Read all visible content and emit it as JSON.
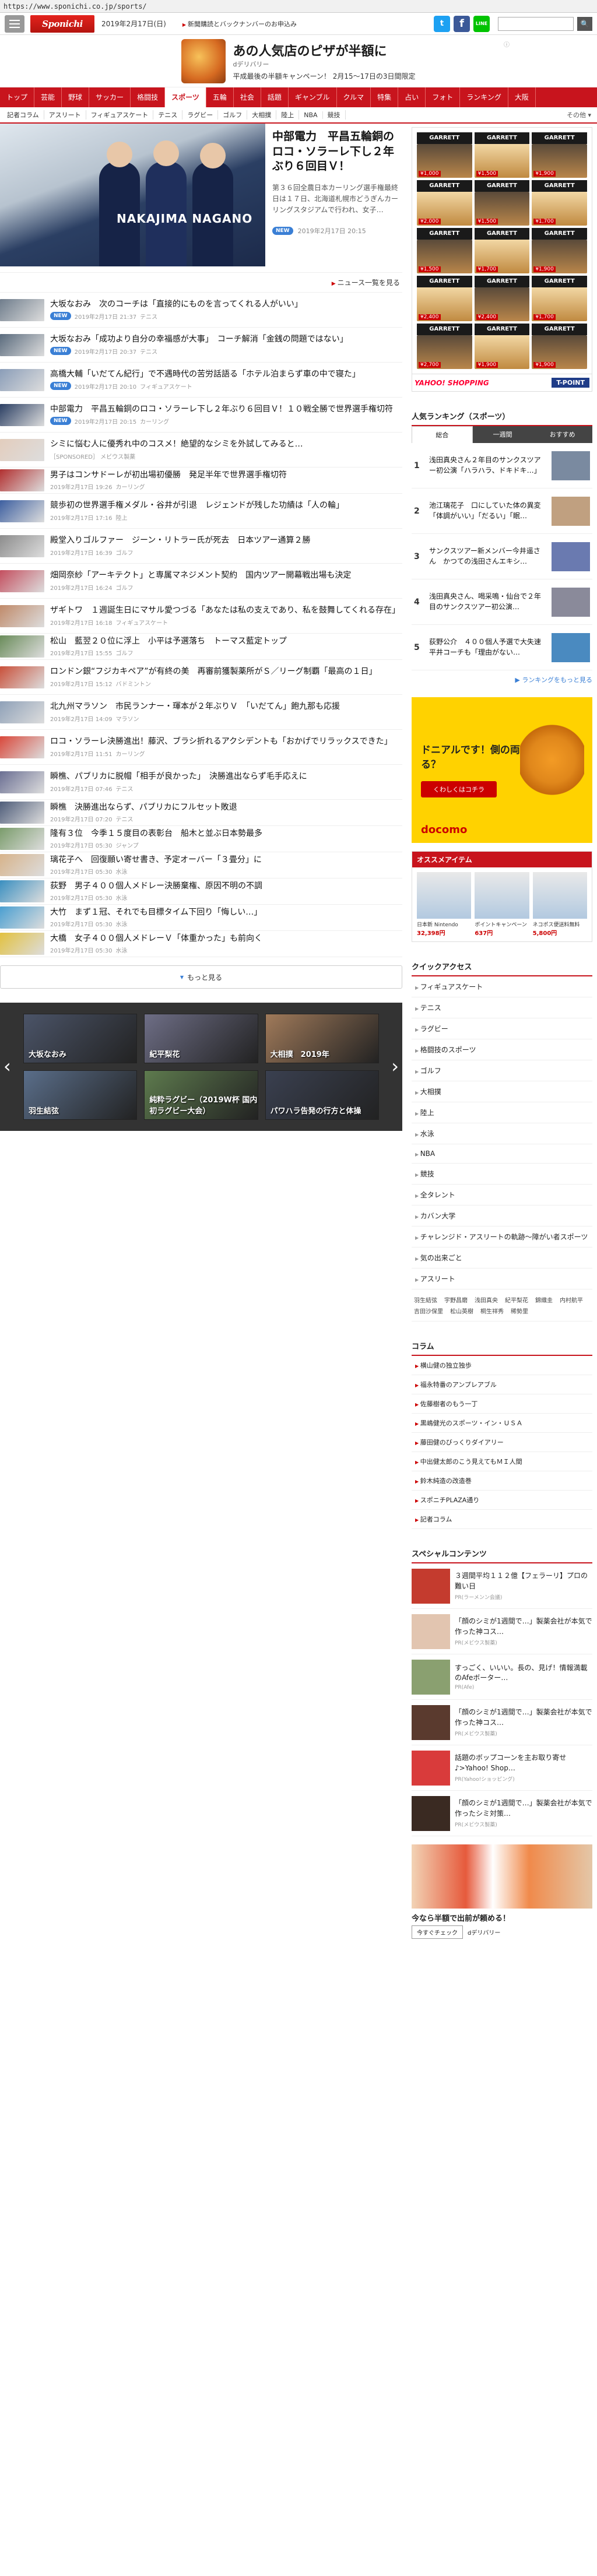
{
  "browser": {
    "url": "https://www.sponichi.co.jp/sports/"
  },
  "header": {
    "logo_text": "Sponichi Annex",
    "date": "2019年2月17日(日)",
    "subscribe": "新聞購読とバックナンバーのお申込み",
    "search_placeholder": "",
    "search_button": "🔍"
  },
  "ad_banner": {
    "title": "あの人気店のピザが半額に",
    "sub": "dデリバリー",
    "campaign": "平成最後の半額キャンペーン！ 2月15～17日の3日間限定",
    "info": "ⓘ"
  },
  "nav": {
    "categories": [
      "トップ",
      "芸能",
      "野球",
      "サッカー",
      "格闘技",
      "スポーツ",
      "五輪",
      "社会",
      "話題",
      "ギャンブル",
      "クルマ",
      "特集",
      "占い",
      "フォト",
      "ランキング",
      "大阪"
    ],
    "active": "スポーツ",
    "sub": [
      "記者コラム",
      "アスリート",
      "フィギュアスケート",
      "テニス",
      "ラグビー",
      "ゴルフ",
      "大相撲",
      "陸上",
      "NBA",
      "競技"
    ],
    "sub_more": "その他 ▾"
  },
  "hero": {
    "title": "中部電力　平昌五輪銅のロコ・ソラーレ下し２年ぶり６回目Ｖ！",
    "desc": "第３６回全農日本カーリング選手権最終日は１７日、北海道札幌市どうぎんカーリングスタジアムで行われ、女子…",
    "badge": "NEW",
    "time": "2019年2月17日 20:15",
    "banner_text": "NAKAJIMA  NAGANO"
  },
  "news_list_link": "ニュース一覧を見る",
  "articles": [
    {
      "title": "大坂なおみ　次のコーチは「直接的にものを言ってくれる人がいい」",
      "meta": "2019年2月17日 21:37",
      "cat": "テニス",
      "new": true,
      "color": "#6f7d8c"
    },
    {
      "title": "大坂なおみ「成功より自分の幸福感が大事」　コーチ解消「金銭の問題ではない」",
      "meta": "2019年2月17日 20:37",
      "cat": "テニス",
      "new": true,
      "color": "#5a6b7d"
    },
    {
      "title": "高橋大輔「いだてん紀行」で不遇時代の苦労話語る「ホテル泊まらず車の中で寝た」",
      "meta": "2019年2月17日 20:10",
      "cat": "フィギュアスケート",
      "new": true,
      "color": "#8a9db8"
    },
    {
      "title": "中部電力　平昌五輪銅のロコ・ソラーレ下し２年ぶり６回目Ｖ！１０戦全勝で世界選手権切符",
      "meta": "2019年2月17日 20:15",
      "cat": "カーリング",
      "new": true,
      "color": "#2b3f63"
    },
    {
      "title": "シミに悩む人に優秀れ中のコスメ！絶望的なシミを外試してみると…",
      "meta": "［SPONSORED］ メビウス製薬",
      "cat": "",
      "new": false,
      "color": "#e3cdbd"
    },
    {
      "title": "男子はコンサドーレが初出場初優勝　発足半年で世界選手権切符",
      "meta": "2019年2月17日 19:26",
      "cat": "カーリング",
      "new": false,
      "color": "#b23030"
    },
    {
      "title": "競歩初の世界選手権メダル・谷井が引退　レジェンドが残した功績は「人の輪」",
      "meta": "2019年2月17日 17:16",
      "cat": "陸上",
      "new": false,
      "color": "#3d5fa0"
    },
    {
      "title": "殿堂入りゴルファー　ジーン・リトラー氏が死去　日本ツアー通算２勝",
      "meta": "2019年2月17日 16:39",
      "cat": "ゴルフ",
      "new": false,
      "color": "#8c8c8c"
    },
    {
      "title": "畑岡奈紗「アーキテクト」と専属マネジメント契約　国内ツアー開幕戦出場も決定",
      "meta": "2019年2月17日 16:24",
      "cat": "ゴルフ",
      "new": false,
      "color": "#c44f5f"
    },
    {
      "title": "ザギトワ　１週誕生日にマサル愛つづる「あなたは私の支えであり、私を鼓舞してくれる存在」",
      "meta": "2019年2月17日 16:18",
      "cat": "フィギュアスケート",
      "new": false,
      "color": "#c08a6a"
    },
    {
      "title": "松山　藍翌２０位に浮上　小平は予選落ち　トーマス藍定トップ",
      "meta": "2019年2月17日 15:55",
      "cat": "ゴルフ",
      "new": false,
      "color": "#6a8c5a"
    },
    {
      "title": "ロンドン銀“フジカキペア”が有終の美　再審前獲製薬所がＳ／リーグ制覇「最高の１日」",
      "meta": "2019年2月17日 15:12",
      "cat": "バドミントン",
      "new": false,
      "color": "#c9503a"
    },
    {
      "title": "北九州マラソン　市民ランナー・琿本が２年ぶりＶ　「いだてん」飽九那も応援",
      "meta": "2019年2月17日 14:09",
      "cat": "マラソン",
      "new": false,
      "color": "#8fa1b8"
    },
    {
      "title": "ロコ・ソラーレ決勝進出！藤沢、ブラシ折れるアクシデントも「おかげでリラックスできた」",
      "meta": "2019年2月17日 11:51",
      "cat": "カーリング",
      "new": false,
      "color": "#d9483b"
    },
    {
      "title": "瞬樵、パブリカに脱帽「相手が良かった」　決勝進出ならず毛手応えに",
      "meta": "2019年2月17日 07:46",
      "cat": "テニス",
      "new": false,
      "color": "#6b6f93"
    },
    {
      "title": "瞬樵　決勝進出ならず、パブリカにフルセット敗退",
      "meta": "2019年2月17日 07:20",
      "cat": "テニス",
      "new": false,
      "color": "#4f5d7a"
    },
    {
      "title": "隆有３位　今季１５度目の表彰台　船木と並ぶ日本勢最多",
      "meta": "2019年2月17日 05:30",
      "cat": "ジャンプ",
      "new": false,
      "color": "#7a9c6b"
    },
    {
      "title": "璃花子へ　回復願い寄せ書き、予定オーバー「３畳分」に",
      "meta": "2019年2月17日 05:30",
      "cat": "水泳",
      "new": false,
      "color": "#d7b38a"
    },
    {
      "title": "荻野　男子４００個人メドレー決勝棄権、原因不明の不調",
      "meta": "2019年2月17日 05:30",
      "cat": "水泳",
      "new": false,
      "color": "#3a8fc0"
    },
    {
      "title": "大竹　まず１冠、それでも目標タイム下回り「悔しい…」",
      "meta": "2019年2月17日 05:30",
      "cat": "水泳",
      "new": false,
      "color": "#4a9fd1"
    },
    {
      "title": "大橋　女子４００個人メドレーＶ「体重かった」も前向く",
      "meta": "2019年2月17日 05:30",
      "cat": "水泳",
      "new": false,
      "color": "#e2c13f"
    }
  ],
  "more_button": "もっと見る",
  "gallery": {
    "row1": [
      "大坂なおみ",
      "紀平梨花",
      "大相撲　2019年"
    ],
    "row2": [
      "羽生結弦",
      "純粋ラグビー（2019W杯 国内初ラグビー大会）",
      "パワハラ告発の行方と体操"
    ]
  },
  "sidebar": {
    "ad_brand": "GARRETT",
    "ad_prices": [
      "¥1,000",
      "¥1,500",
      "¥1,900",
      "¥2,000",
      "¥1,500",
      "¥1,700",
      "¥1,500",
      "¥1,700",
      "¥1,900",
      "¥2,400",
      "¥2,400",
      "¥1,700",
      "¥2,700",
      "¥1,900",
      "¥1,900"
    ],
    "yahoo": "YAHOO! SHOPPING",
    "tpoint": "T-POINT",
    "ranking_title": "人気ランキング（スポーツ）",
    "ranking_tabs": [
      "総合",
      "一週間",
      "おすすめ"
    ],
    "ranking": [
      {
        "n": "1",
        "t": "浅田真央さん２年目のサンクスツアー初公演「ハラハラ、ドキドキ…」"
      },
      {
        "n": "2",
        "t": "池江璃花子　口にしていた体の異変「体調がいい」「だるい」「眠…"
      },
      {
        "n": "3",
        "t": "サンクスツアー新メンバー今井遥さん　かつての浅田さんエキシ…"
      },
      {
        "n": "4",
        "t": "浅田真央さん、喝采鳴・仙台で２年目のサンクスツアー初公演…"
      },
      {
        "n": "5",
        "t": "荻野公介　４００個人予選で大失速　平井コーチも「理由がない…"
      }
    ],
    "ranking_more": "ランキングをもっと見る",
    "docomo_q": "ドニアルです！側の両案の形しってる？",
    "docomo_cta": "くわしくはコチラ",
    "docomo_brand": "docomo",
    "items_title": "オススメアイテム",
    "items": [
      {
        "name": "日本新 Nintendo",
        "price": "32,398円"
      },
      {
        "name": "ポイントキャンペーン",
        "price": "637円"
      },
      {
        "name": "ネコポス便送料無料",
        "price": "5,800円"
      }
    ],
    "quick_title": "クイックアクセス",
    "quick": [
      "フィギュアスケート",
      "テニス",
      "ラグビー",
      "格闘技のスポーツ",
      "ゴルフ",
      "大相撲",
      "陸上",
      "水泳",
      "NBA",
      "競技",
      "全タレント",
      "カバン大学",
      "チャレンジド・アスリートの軌跡～障がい者スポーツ",
      "気の出来ごと",
      "アスリート"
    ],
    "tags": [
      "羽生結弦",
      "宇野昌磨",
      "浅田真央",
      "紀平梨花",
      "錦織圭",
      "内村航平",
      "吉田沙保里",
      "松山英樹",
      "桐生祥秀",
      "稀勢里"
    ],
    "column_title": "コラム",
    "columns": [
      "横山健の独立独歩",
      "福永特番のアンプレアブル",
      "佐藤樹者のもう一丁",
      "黒嶋健光のスポーツ・イン・ＵＳＡ",
      "藤田健のびっくりダイアリー",
      "中出健太郎のこう見えてもＭＩ人間",
      "鈴木純造の改造巻",
      "スポニチPLAZA通り",
      "記者コラム"
    ],
    "special_title": "スペシャルコンテンツ",
    "special": [
      {
        "t": "３週間平均１１２億【フェラーリ】プロの難い日",
        "pr": "PR(ラーメンン会議)",
        "c": "#c43b2e"
      },
      {
        "t": "「顔のシミが1週間で…」製薬会社が本気で作った神コス…",
        "pr": "PR(メビウス製薬)",
        "c": "#e2c5b0"
      },
      {
        "t": "すっごく、いいい。長の、見げ！情報満載のAfeボーター…",
        "pr": "PR(Afe)",
        "c": "#8aa070"
      },
      {
        "t": "「顔のシミが1週間で…」製薬会社が本気で作った神コス…",
        "pr": "PR(メビウス製薬)",
        "c": "#5a3a2e"
      },
      {
        "t": "話題のボップコーンを主お取り寄せ♪>Yahoo! Shop…",
        "pr": "PR(Yahoo!ショッピング)",
        "c": "#d93b3b"
      },
      {
        "t": "「顔のシミが1週間で…」製薬会社が本気で作ったシミ対策…",
        "pr": "PR(メビウス製薬)",
        "c": "#3a2a22"
      }
    ],
    "sushi_caption": "今なら半額で出前が頼める！",
    "sushi_btn": "今すぐチェック",
    "sushi_brand": "dデリバリー"
  }
}
